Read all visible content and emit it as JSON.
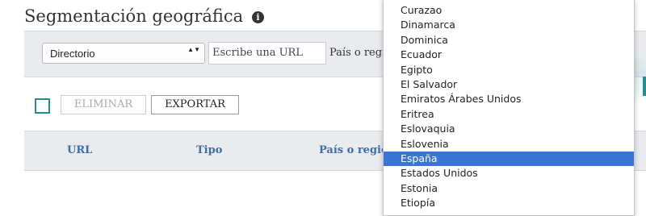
{
  "page": {
    "title": "Segmentación geográfica",
    "info_icon": "i"
  },
  "filters": {
    "select_value": "Directorio",
    "select_arrows": "▲▼",
    "url_placeholder": "Escribe una URL",
    "country_label": "País o región"
  },
  "actions": {
    "delete_label": "ELIMINAR",
    "export_label": "EXPORTAR"
  },
  "table": {
    "columns": [
      "URL",
      "Tipo",
      "País o región"
    ]
  },
  "dropdown": {
    "options": [
      "Curazao",
      "Dinamarca",
      "Dominica",
      "Ecuador",
      "Egipto",
      "El Salvador",
      "Emiratos Árabes Unidos",
      "Eritrea",
      "Eslovaquia",
      "Eslovenia",
      "España",
      "Estados Unidos",
      "Estonia",
      "Etiopía"
    ],
    "selected_index": 10
  },
  "colors": {
    "accent": "#2a8a93",
    "link": "#3c6fa6",
    "selected": "#3875d7"
  }
}
